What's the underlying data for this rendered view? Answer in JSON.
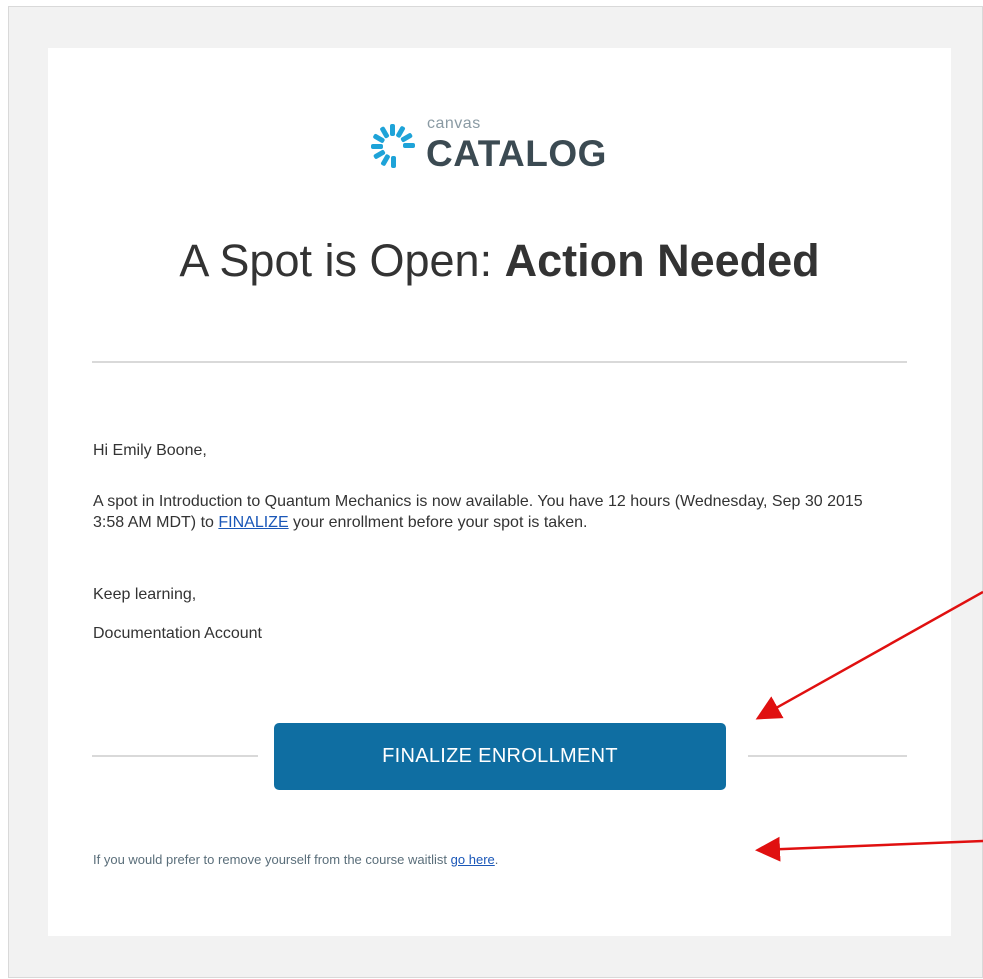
{
  "logo": {
    "small": "canvas",
    "big": "CATALOG",
    "mark_color": "#1ea3d8"
  },
  "headline": {
    "regular": "A Spot is Open: ",
    "bold": "Action Needed"
  },
  "email": {
    "greeting": "Hi Emily Boone,",
    "main_before": "A spot in Introduction to Quantum Mechanics is now available. You have 12 hours (Wednesday, Sep 30 2015 3:58 AM MDT) to ",
    "main_link": "FINALIZE",
    "main_after": " your enrollment before your spot is taken.",
    "closing": "Keep learning,",
    "signature": "Documentation Account"
  },
  "button": {
    "label": "FINALIZE ENROLLMENT",
    "color": "#0f6ea2"
  },
  "footer": {
    "text_before": "If you would prefer to remove yourself from the course waitlist ",
    "link": "go here",
    "text_after": "."
  },
  "annotations": {
    "arrow_color": "#e01010"
  }
}
